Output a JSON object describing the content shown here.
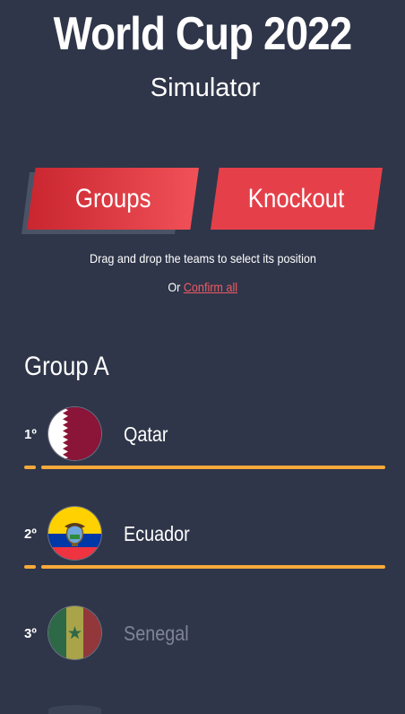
{
  "header": {
    "title": "World Cup 2022",
    "subtitle": "Simulator"
  },
  "tabs": {
    "groups_label": "Groups",
    "knockout_label": "Knockout"
  },
  "instructions": {
    "drag_text": "Drag and drop the teams to select its position",
    "or_text": "Or ",
    "confirm_link": "Confirm all"
  },
  "group": {
    "title": "Group A",
    "teams": [
      {
        "position": "1º",
        "name": "Qatar",
        "flag": "qatar-flag-icon",
        "confirmed": true
      },
      {
        "position": "2º",
        "name": "Ecuador",
        "flag": "ecuador-flag-icon",
        "confirmed": true
      },
      {
        "position": "3º",
        "name": "Senegal",
        "flag": "senegal-flag-icon",
        "confirmed": false
      }
    ]
  },
  "colors": {
    "background": "#2f3649",
    "accent_red": "#e5404a",
    "confirm_bar": "#f6a93b",
    "link": "#f05a63"
  }
}
